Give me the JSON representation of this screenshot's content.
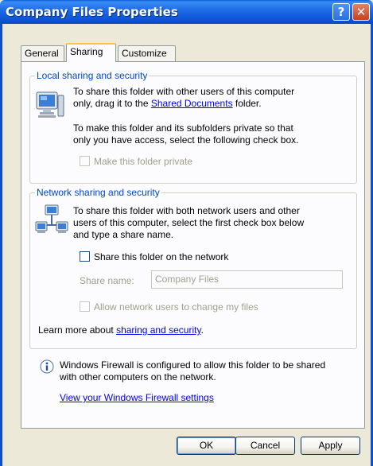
{
  "window": {
    "title": "Company Files Properties",
    "help_glyph": "?",
    "close_glyph": "✕"
  },
  "tabs": [
    {
      "label": "General",
      "active": false
    },
    {
      "label": "Sharing",
      "active": true
    },
    {
      "label": "Customize",
      "active": false
    }
  ],
  "local": {
    "legend": "Local sharing and security",
    "line1": "To share this folder with other users of this computer",
    "line2_prefix": "only, drag it to the ",
    "line2_link": "Shared Documents",
    "line2_suffix": " folder.",
    "line3": "To make this folder and its subfolders private so that",
    "line4": "only you have access, select the following check box.",
    "private_checkbox_label": "Make this folder private",
    "private_checked": false
  },
  "network": {
    "legend": "Network sharing and security",
    "line1": "To share this folder with both network users and other",
    "line2": "users of this computer, select the first check box below",
    "line3": "and type a share name.",
    "share_checkbox_label": "Share this folder on the network",
    "share_checked": false,
    "share_name_label": "Share name:",
    "share_name_value": "Company Files",
    "allow_checkbox_label": "Allow network users to change my files",
    "allow_checked": false,
    "learn_prefix": "Learn more about ",
    "learn_link": "sharing and security",
    "learn_suffix": "."
  },
  "firewall": {
    "icon": "info-icon",
    "line1": "Windows Firewall is configured to allow this folder to be shared",
    "line2": "with other computers on the network.",
    "settings_link": "View your Windows Firewall settings"
  },
  "buttons": {
    "ok": "OK",
    "cancel": "Cancel",
    "apply": "Apply"
  },
  "colors": {
    "titlebar": "#0b53d3",
    "legend": "#0046d5",
    "link": "#0000ee",
    "dialog_bg": "#ece9d8"
  }
}
